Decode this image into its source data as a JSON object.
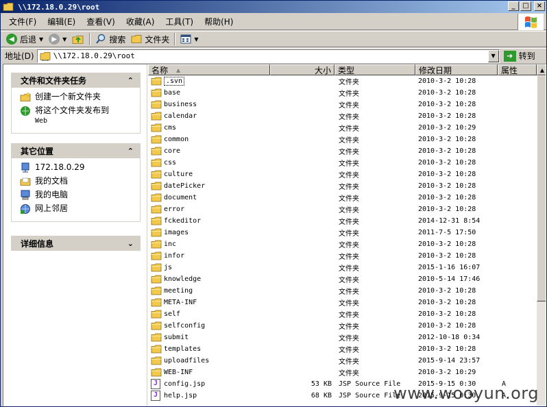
{
  "window": {
    "title": "\\\\172.18.0.29\\root"
  },
  "titlebar_buttons": {
    "minimize": "_",
    "maximize": "□",
    "close": "×"
  },
  "menu": [
    "文件(F)",
    "编辑(E)",
    "查看(V)",
    "收藏(A)",
    "工具(T)",
    "帮助(H)"
  ],
  "toolbar": {
    "back_label": "后退",
    "search_label": "搜索",
    "folders_label": "文件夹"
  },
  "address": {
    "label": "地址(D)",
    "value": "\\\\172.18.0.29\\root",
    "go_label": "转到"
  },
  "tasks_panel": {
    "title": "文件和文件夹任务",
    "items": [
      {
        "label": "创建一个新文件夹",
        "icon": "new-folder-icon"
      },
      {
        "label": "将这个文件夹发布到",
        "sub": "Web",
        "icon": "publish-web-icon"
      }
    ]
  },
  "other_places": {
    "title": "其它位置",
    "items": [
      {
        "label": "172.18.0.29",
        "icon": "network-share-icon"
      },
      {
        "label": "我的文档",
        "icon": "my-documents-icon"
      },
      {
        "label": "我的电脑",
        "icon": "my-computer-icon"
      },
      {
        "label": "网上邻居",
        "icon": "network-places-icon"
      }
    ]
  },
  "details_panel": {
    "title": "详细信息"
  },
  "columns": {
    "name": "名称",
    "size": "大小",
    "type": "类型",
    "modified": "修改日期",
    "attributes": "属性"
  },
  "files": [
    {
      "name": ".svn",
      "size": "",
      "type": "文件夹",
      "modified": "2010-3-2 10:28",
      "attr": "",
      "kind": "folder"
    },
    {
      "name": "base",
      "size": "",
      "type": "文件夹",
      "modified": "2010-3-2 10:28",
      "attr": "",
      "kind": "folder"
    },
    {
      "name": "business",
      "size": "",
      "type": "文件夹",
      "modified": "2010-3-2 10:28",
      "attr": "",
      "kind": "folder"
    },
    {
      "name": "calendar",
      "size": "",
      "type": "文件夹",
      "modified": "2010-3-2 10:28",
      "attr": "",
      "kind": "folder"
    },
    {
      "name": "cms",
      "size": "",
      "type": "文件夹",
      "modified": "2010-3-2 10:29",
      "attr": "",
      "kind": "folder"
    },
    {
      "name": "common",
      "size": "",
      "type": "文件夹",
      "modified": "2010-3-2 10:28",
      "attr": "",
      "kind": "folder"
    },
    {
      "name": "core",
      "size": "",
      "type": "文件夹",
      "modified": "2010-3-2 10:28",
      "attr": "",
      "kind": "folder"
    },
    {
      "name": "css",
      "size": "",
      "type": "文件夹",
      "modified": "2010-3-2 10:28",
      "attr": "",
      "kind": "folder"
    },
    {
      "name": "culture",
      "size": "",
      "type": "文件夹",
      "modified": "2010-3-2 10:28",
      "attr": "",
      "kind": "folder"
    },
    {
      "name": "datePicker",
      "size": "",
      "type": "文件夹",
      "modified": "2010-3-2 10:28",
      "attr": "",
      "kind": "folder"
    },
    {
      "name": "document",
      "size": "",
      "type": "文件夹",
      "modified": "2010-3-2 10:28",
      "attr": "",
      "kind": "folder"
    },
    {
      "name": "error",
      "size": "",
      "type": "文件夹",
      "modified": "2010-3-2 10:28",
      "attr": "",
      "kind": "folder"
    },
    {
      "name": "fckeditor",
      "size": "",
      "type": "文件夹",
      "modified": "2014-12-31 8:54",
      "attr": "",
      "kind": "folder"
    },
    {
      "name": "images",
      "size": "",
      "type": "文件夹",
      "modified": "2011-7-5 17:50",
      "attr": "",
      "kind": "folder"
    },
    {
      "name": "inc",
      "size": "",
      "type": "文件夹",
      "modified": "2010-3-2 10:28",
      "attr": "",
      "kind": "folder"
    },
    {
      "name": "infor",
      "size": "",
      "type": "文件夹",
      "modified": "2010-3-2 10:28",
      "attr": "",
      "kind": "folder"
    },
    {
      "name": "js",
      "size": "",
      "type": "文件夹",
      "modified": "2015-1-16 16:07",
      "attr": "",
      "kind": "folder"
    },
    {
      "name": "knowledge",
      "size": "",
      "type": "文件夹",
      "modified": "2010-5-14 17:46",
      "attr": "",
      "kind": "folder"
    },
    {
      "name": "meeting",
      "size": "",
      "type": "文件夹",
      "modified": "2010-3-2 10:28",
      "attr": "",
      "kind": "folder"
    },
    {
      "name": "META-INF",
      "size": "",
      "type": "文件夹",
      "modified": "2010-3-2 10:28",
      "attr": "",
      "kind": "folder"
    },
    {
      "name": "self",
      "size": "",
      "type": "文件夹",
      "modified": "2010-3-2 10:28",
      "attr": "",
      "kind": "folder"
    },
    {
      "name": "selfconfig",
      "size": "",
      "type": "文件夹",
      "modified": "2010-3-2 10:28",
      "attr": "",
      "kind": "folder"
    },
    {
      "name": "submit",
      "size": "",
      "type": "文件夹",
      "modified": "2012-10-18 0:34",
      "attr": "",
      "kind": "folder"
    },
    {
      "name": "templates",
      "size": "",
      "type": "文件夹",
      "modified": "2010-3-2 10:28",
      "attr": "",
      "kind": "folder"
    },
    {
      "name": "uploadfiles",
      "size": "",
      "type": "文件夹",
      "modified": "2015-9-14 23:57",
      "attr": "",
      "kind": "folder"
    },
    {
      "name": "WEB-INF",
      "size": "",
      "type": "文件夹",
      "modified": "2010-3-2 10:29",
      "attr": "",
      "kind": "folder"
    },
    {
      "name": "config.jsp",
      "size": "53 KB",
      "type": "JSP Source File",
      "modified": "2015-9-15 0:30",
      "attr": "A",
      "kind": "jsp"
    },
    {
      "name": "help.jsp",
      "size": "68 KB",
      "type": "JSP Source File",
      "modified": "2015-9-15 0:30",
      "attr": "A",
      "kind": "jsp"
    }
  ],
  "watermark": "www.wooyun.org",
  "colors": {
    "titlebar_start": "#0a246a",
    "titlebar_end": "#a6caf0",
    "chrome": "#d4d0c8",
    "folder": "#f2c94c"
  }
}
